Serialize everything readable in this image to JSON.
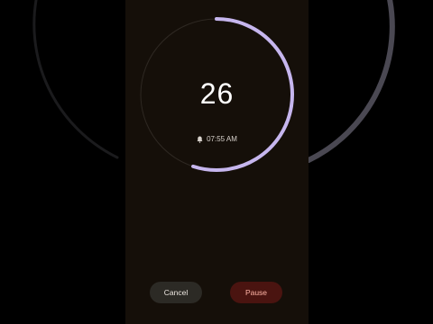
{
  "timer": {
    "remaining": "26",
    "alarm_time": "07:55 AM",
    "progress_fraction": 0.55,
    "ring_color": "#c6b6ee",
    "track_color": "#2e2822"
  },
  "icons": {
    "alarm": "bell-icon"
  },
  "actions": {
    "cancel_label": "Cancel",
    "pause_label": "Pause"
  },
  "colors": {
    "screen_bg": "#150f09",
    "cancel_bg": "#2c2a25",
    "pause_bg": "#4a1410",
    "pause_text": "#ffb4a6"
  }
}
